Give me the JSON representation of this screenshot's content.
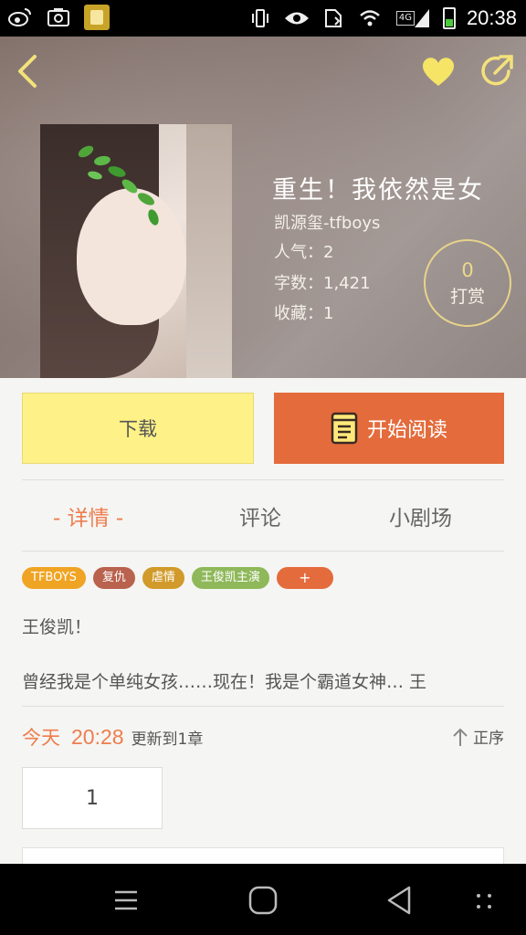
{
  "status_bar": {
    "time": "20:38",
    "network": "4G",
    "left_icons": [
      "weibo-icon",
      "camera-icon",
      "book-app-icon"
    ],
    "right_icons": [
      "vibrate-icon",
      "eye-icon",
      "sim-icon",
      "wifi-icon",
      "signal-icon",
      "battery-icon"
    ]
  },
  "header": {
    "back": "back-icon",
    "favorite": "heart-icon",
    "share": "share-icon"
  },
  "book": {
    "title": "重生！我依然是女",
    "author": "凯源玺-tfboys",
    "popularity": "人气：2",
    "word_count": "字数：1,421",
    "collections": "收藏：1",
    "tip_count": "0",
    "tip_label": "打赏"
  },
  "actions": {
    "download": "下载",
    "start_reading": "开始阅读"
  },
  "tabs": [
    {
      "label": "- 详情 -",
      "active": true
    },
    {
      "label": "评论",
      "active": false
    },
    {
      "label": "小剧场",
      "active": false
    }
  ],
  "tags": [
    {
      "label": "TFBOYS",
      "color": "#f0a424"
    },
    {
      "label": "复仇",
      "color": "#b9624e"
    },
    {
      "label": "虐情",
      "color": "#d19a2a"
    },
    {
      "label": "王俊凯主演",
      "color": "#8fb85a"
    },
    {
      "label": "+",
      "color": "#e46b3c"
    }
  ],
  "intro": {
    "line1": "王俊凯！",
    "line2": "曾经我是个单纯女孩……现在！我是个霸道女神… 王"
  },
  "update": {
    "today": "今天",
    "time": "20:28",
    "text": "更新到1章",
    "sort_label": "正序"
  },
  "chapters": [
    "1"
  ],
  "colors": {
    "accent": "#ee7d4d",
    "download_bg": "#fdf187",
    "read_bg": "#e46b3c"
  }
}
